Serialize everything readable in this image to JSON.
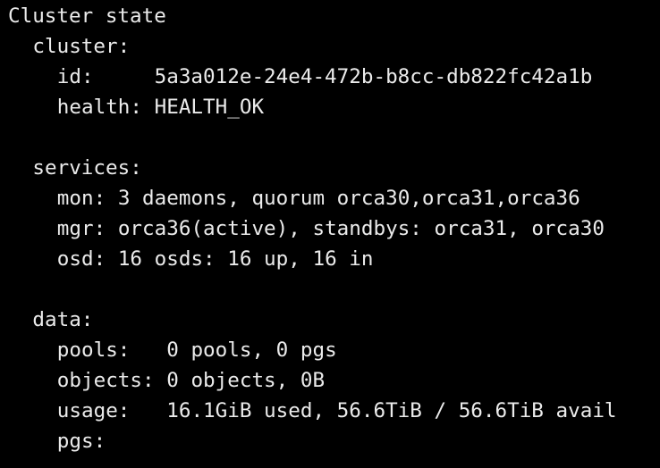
{
  "terminal": {
    "heading": "Cluster state",
    "cluster": {
      "label": "cluster:",
      "id_key": "id:",
      "id_pad": "     ",
      "id_value": "5a3a012e-24e4-472b-b8cc-db822fc42a1b",
      "health_key": "health:",
      "health_value": "HEALTH_OK"
    },
    "services": {
      "label": "services:",
      "mon_key": "mon:",
      "mon_value": "3 daemons, quorum orca30,orca31,orca36",
      "mgr_key": "mgr:",
      "mgr_value": "orca36(active), standbys: orca31, orca30",
      "osd_key": "osd:",
      "osd_value": "16 osds: 16 up, 16 in"
    },
    "data": {
      "label": "data:",
      "pools_key": "pools:",
      "pools_pad": "   ",
      "pools_value": "0 pools, 0 pgs",
      "objects_key": "objects:",
      "objects_value": "0 objects, 0B",
      "usage_key": "usage:",
      "usage_pad": "   ",
      "usage_value": "16.1GiB used, 56.6TiB / 56.6TiB avail",
      "pgs_key": "pgs:"
    }
  }
}
